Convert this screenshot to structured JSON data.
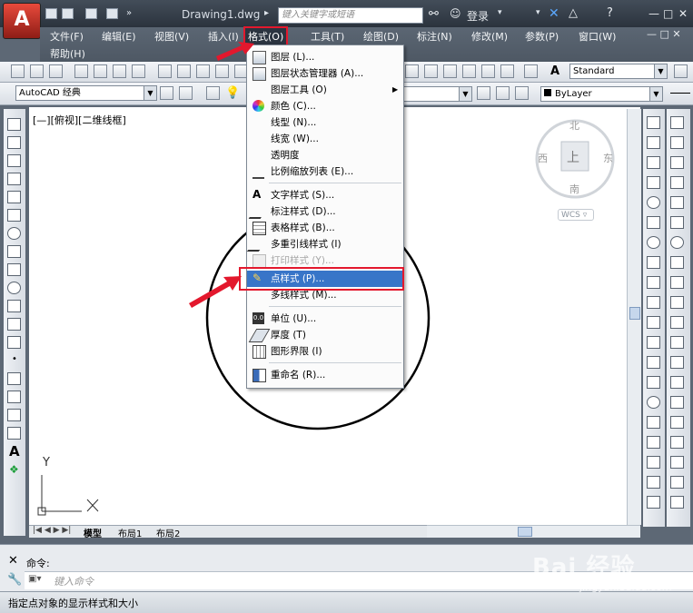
{
  "app": {
    "title": "Drawing1.dwg",
    "search_placeholder": "键入关键字或短语",
    "login": "登录"
  },
  "menu": {
    "items": [
      "文件(F)",
      "编辑(E)",
      "视图(V)",
      "插入(I)",
      "格式(O)",
      "工具(T)",
      "绘图(D)",
      "标注(N)",
      "修改(M)",
      "参数(P)",
      "窗口(W)",
      "帮助(H)"
    ],
    "active": "格式(O)"
  },
  "toolbar": {
    "workspace": "AutoCAD 经典",
    "text_style": "Standard",
    "color": "ByLayer"
  },
  "viewport": {
    "label": "[—][俯视][二维线框]",
    "compass": {
      "north": "北",
      "south": "南",
      "east": "东",
      "west": "西",
      "center": "上",
      "wcs": "WCS"
    },
    "ucs": {
      "y": "Y",
      "x": "X"
    }
  },
  "format_menu": {
    "items": [
      {
        "label": "图层 (L)...",
        "icon": "layer-icon",
        "disabled": false
      },
      {
        "label": "图层状态管理器 (A)...",
        "icon": "layer-state-icon",
        "disabled": false
      },
      {
        "label": "图层工具 (O)",
        "icon": "",
        "disabled": false,
        "submenu": true
      },
      {
        "label": "颜色 (C)...",
        "icon": "color-wheel-icon",
        "disabled": false
      },
      {
        "label": "线型 (N)...",
        "icon": "",
        "disabled": false
      },
      {
        "label": "线宽 (W)...",
        "icon": "",
        "disabled": false
      },
      {
        "label": "透明度",
        "icon": "",
        "disabled": false
      },
      {
        "label": "比例缩放列表 (E)...",
        "icon": "scale-list-icon",
        "disabled": false
      },
      {
        "label": "文字样式 (S)...",
        "icon": "text-style-icon",
        "disabled": false
      },
      {
        "label": "标注样式 (D)...",
        "icon": "dim-style-icon",
        "disabled": false
      },
      {
        "label": "表格样式 (B)...",
        "icon": "table-style-icon",
        "disabled": false
      },
      {
        "label": "多重引线样式 (I)",
        "icon": "mleader-style-icon",
        "disabled": false
      },
      {
        "label": "打印样式 (Y)...",
        "icon": "plot-style-icon",
        "disabled": true
      },
      {
        "label": "点样式 (P)...",
        "icon": "point-style-icon",
        "disabled": false,
        "highlighted": true
      },
      {
        "label": "多线样式 (M)...",
        "icon": "",
        "disabled": false
      },
      {
        "label": "单位 (U)...",
        "icon": "units-icon",
        "disabled": false
      },
      {
        "label": "厚度 (T)",
        "icon": "thickness-icon",
        "disabled": false
      },
      {
        "label": "图形界限 (I)",
        "icon": "limits-icon",
        "disabled": false
      },
      {
        "label": "重命名 (R)...",
        "icon": "rename-icon",
        "disabled": false
      }
    ]
  },
  "layout_tabs": [
    "模型",
    "布局1",
    "布局2"
  ],
  "command": {
    "prompt": "命令:",
    "input_placeholder": "键入命令"
  },
  "status": {
    "text": "指定点对象的显示样式和大小"
  },
  "watermark": {
    "brand": "Bai 经验",
    "url": "jingyan.baidu.com"
  }
}
